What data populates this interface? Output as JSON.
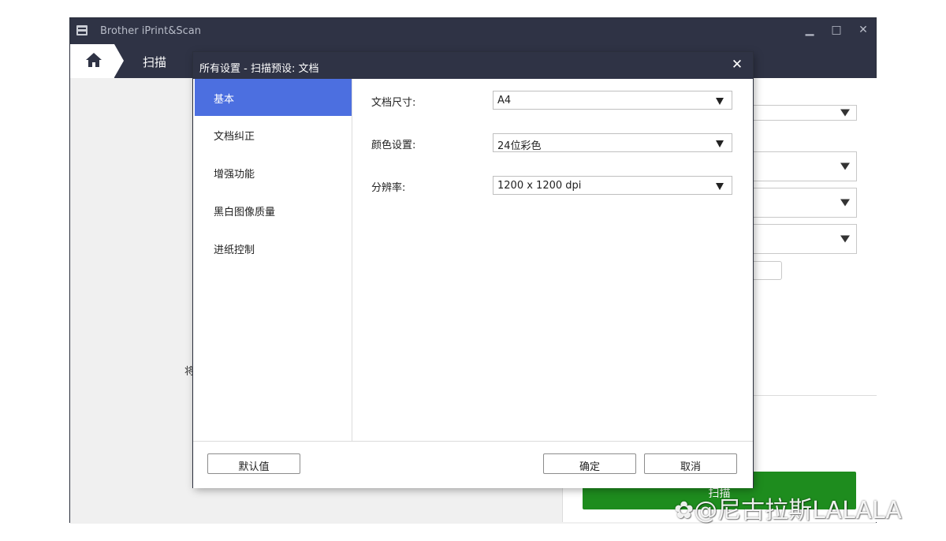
{
  "app": {
    "title": "Brother iPrint&Scan",
    "nav_tab": "扫描",
    "left_fragment": "将",
    "scan_button": "扫描"
  },
  "dialog": {
    "title": "所有设置 - 扫描预设: 文档",
    "sidebar": [
      {
        "label": "基本",
        "active": true
      },
      {
        "label": "文档纠正",
        "active": false
      },
      {
        "label": "增强功能",
        "active": false
      },
      {
        "label": "黑白图像质量",
        "active": false
      },
      {
        "label": "进纸控制",
        "active": false
      }
    ],
    "fields": [
      {
        "label": "文档尺寸:",
        "value": "A4"
      },
      {
        "label": "颜色设置:",
        "value": "24位彩色"
      },
      {
        "label": "分辨率:",
        "value": "1200 x 1200 dpi"
      }
    ],
    "buttons": {
      "default": "默认值",
      "ok": "确定",
      "cancel": "取消"
    }
  },
  "watermark": "@尼古拉斯LALALA",
  "colors": {
    "titlebar": "#2f3345",
    "sidebar_active": "#4c6fe0",
    "scan_button": "#1e8c1e"
  },
  "icons": [
    "app-printer-icon",
    "home-icon",
    "minimize-icon",
    "maximize-icon",
    "close-icon",
    "chevron-down-icon",
    "paw-icon"
  ]
}
